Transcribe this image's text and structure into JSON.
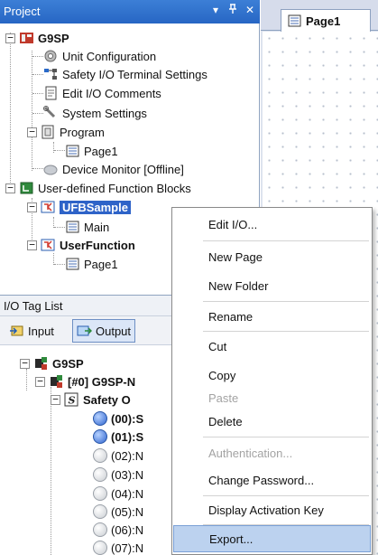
{
  "project_pane": {
    "title": "Project",
    "controls": {
      "dropdown": "▾",
      "pin": "ᵖ",
      "close": "✕"
    },
    "tree": {
      "root": "G9SP",
      "unit_configuration": "Unit Configuration",
      "safety_io_terminal": "Safety I/O Terminal Settings",
      "edit_io_comments": "Edit I/O Comments",
      "system_settings": "System Settings",
      "program": "Program",
      "program_page1": "Page1",
      "device_monitor": "Device Monitor [Offline]",
      "ufb_root": "User-defined Function Blocks",
      "ufb_sample": "UFBSample",
      "ufb_main": "Main",
      "user_function": "UserFunction",
      "user_function_page1": "Page1"
    }
  },
  "editor": {
    "tab_label": "Page1"
  },
  "io_pane": {
    "title": "I/O Tag List",
    "input_label": "Input",
    "output_label": "Output",
    "tree": {
      "root": "G9SP",
      "node0": "[#0] G9SP-N",
      "safety": "Safety O",
      "items": [
        "(00):S",
        "(01):S",
        "(02):N",
        "(03):N",
        "(04):N",
        "(05):N",
        "(06):N",
        "(07):N"
      ]
    }
  },
  "context_menu": {
    "items": [
      {
        "label": "Edit I/O...",
        "disabled": false
      },
      {
        "label": "New Page",
        "disabled": false
      },
      {
        "label": "New Folder",
        "disabled": false
      },
      {
        "label": "Rename",
        "disabled": false
      },
      {
        "label": "Cut",
        "disabled": false
      },
      {
        "label": "Copy",
        "disabled": false
      },
      {
        "label": "Paste",
        "disabled": true
      },
      {
        "label": "Delete",
        "disabled": false
      },
      {
        "label": "Authentication...",
        "disabled": true
      },
      {
        "label": "Change Password...",
        "disabled": false
      },
      {
        "label": "Display Activation Key",
        "disabled": false
      },
      {
        "label": "Export...",
        "disabled": false,
        "highlighted": true
      }
    ]
  },
  "colors": {
    "title_bar": "#2766c4",
    "selection": "#2e63c8",
    "menu_hover": "#bcd2ef"
  }
}
